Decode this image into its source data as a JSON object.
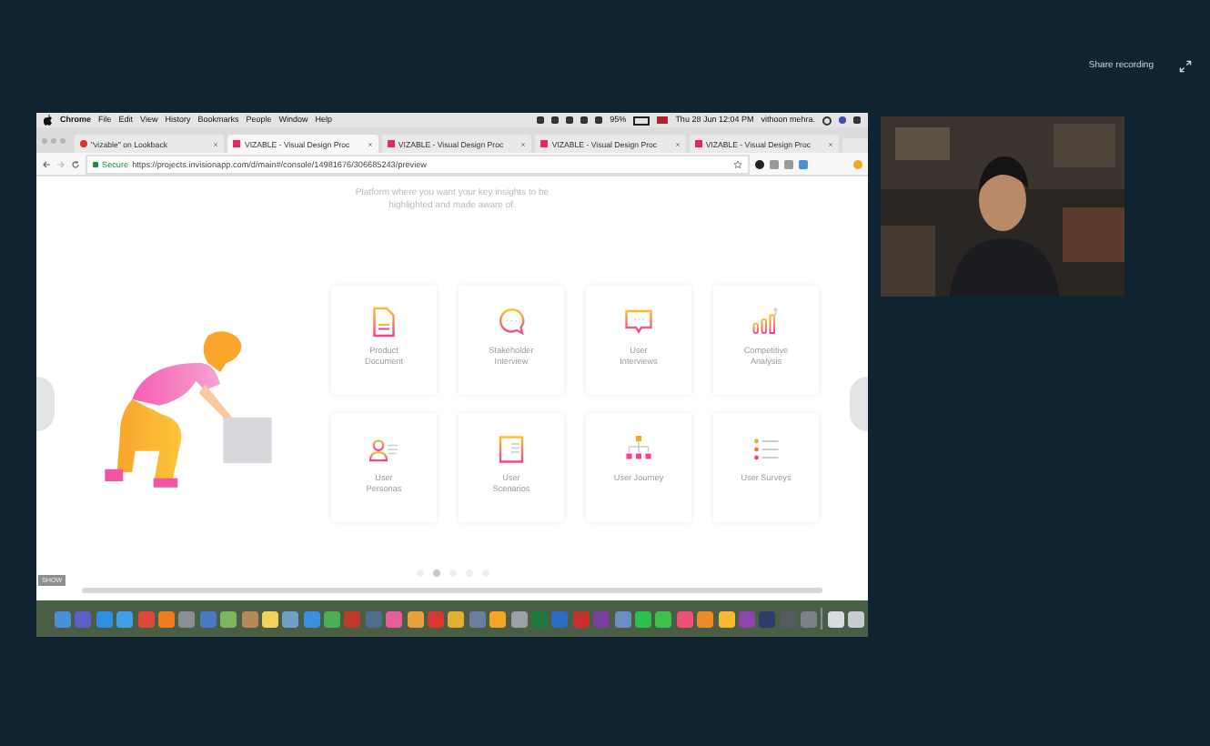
{
  "call": {
    "status_text": "Share recording"
  },
  "menu_bar": {
    "app": "Chrome",
    "items": [
      "File",
      "Edit",
      "View",
      "History",
      "Bookmarks",
      "People",
      "Window",
      "Help"
    ],
    "battery": "95%",
    "clock": "Thu 28 Jun 12:04 PM",
    "user": "vithoon mehra."
  },
  "tabs": [
    {
      "title": "\"vizable\" on Lookback",
      "kind": "lookback",
      "selected": false
    },
    {
      "title": "VIZABLE - Visual Design Proc",
      "kind": "invision",
      "selected": true
    },
    {
      "title": "VIZABLE - Visual Design Proc",
      "kind": "invision",
      "selected": false
    },
    {
      "title": "VIZABLE - Visual Design Proc",
      "kind": "invision",
      "selected": false
    },
    {
      "title": "VIZABLE - Visual Design Proc",
      "kind": "invision",
      "selected": false
    }
  ],
  "address_bar": {
    "secure_label": "Secure",
    "url": "https://projects.invisionapp.com/d/main#/console/14981676/306685243/preview"
  },
  "page": {
    "subtitle": "Platform where you want your key insights to be highlighted and made aware of.",
    "cards": [
      {
        "label": "Product Document",
        "kind": "document"
      },
      {
        "label": "Stakeholder Interview",
        "kind": "bubble"
      },
      {
        "label": "User Interviews",
        "kind": "message"
      },
      {
        "label": "Competitive Analysis",
        "kind": "chart"
      },
      {
        "label": "User Personas",
        "kind": "persona"
      },
      {
        "label": "User Scenarios",
        "kind": "scenario"
      },
      {
        "label": "User Journey",
        "kind": "journey"
      },
      {
        "label": "User Surveys",
        "kind": "survey"
      }
    ],
    "pager": [
      {
        "selected": false
      },
      {
        "selected": true
      },
      {
        "selected": false
      },
      {
        "selected": false
      },
      {
        "selected": false
      }
    ]
  },
  "overlay_label": "SHOW"
}
